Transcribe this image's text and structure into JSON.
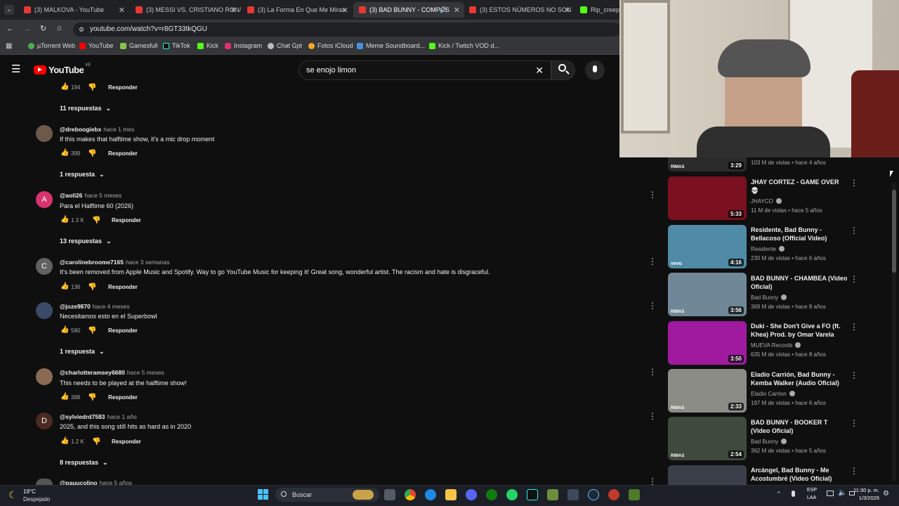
{
  "browser": {
    "tabs": [
      {
        "label": "(3) MALKOVA - YouTube",
        "active": false
      },
      {
        "label": "(3) MESSI VS. CRISTIANO RON/",
        "active": false
      },
      {
        "label": "(3) La Forma En Que Me Miras",
        "active": false
      },
      {
        "label": "(3) BAD BUNNY - COMPOS",
        "active": true
      },
      {
        "label": "(3) ESTOS NÚMEROS NO SON",
        "active": false
      },
      {
        "label": "Rip_creepy S",
        "active": false
      }
    ],
    "url": "youtube.com/watch?v=r8GT33tkQGU",
    "bookmarks": [
      "µTorrent Web",
      "YouTube",
      "Gamesfull",
      "TikTok",
      "Kick",
      "Instagram",
      "Chat Gpt",
      "Fotos iCloud",
      "Meme Soundboard...",
      "Kick / Twitch VOD d..."
    ]
  },
  "youtube": {
    "logo_text": "YouTube",
    "region": "VE",
    "search_value": "se enojo limon"
  },
  "comments": {
    "top_item": {
      "likes": "194",
      "reply_label": "Responder",
      "replies": "11 respuestas"
    },
    "items": [
      {
        "handle": "@dreboogiebx",
        "time": "hace 1 mes",
        "text": "If this makes that halftime show, it's a mic drop moment",
        "likes": "399",
        "reply_label": "Responder",
        "replies": "1 respuesta",
        "avatar_letter": "",
        "avatar_color": "#6b5a4a"
      },
      {
        "handle": "@aoli26",
        "time": "hace 5 meses",
        "text": "Para el Halftime 60 (2026)",
        "likes": "1.3 K",
        "reply_label": "Responder",
        "replies": "13 respuestas",
        "avatar_letter": "A",
        "avatar_color": "#d6336c"
      },
      {
        "handle": "@carolinebroome7165",
        "time": "hace 3 semanas",
        "text": "It's been removed from Apple Music and Spotify. Way to go YouTube Music for keeping it! Great song, wonderful artist. The racism and hate is disgraceful.",
        "likes": "136",
        "reply_label": "Responder",
        "replies": "",
        "avatar_letter": "C",
        "avatar_color": "#616161"
      },
      {
        "handle": "@joze9870",
        "time": "hace 4 meses",
        "text": "Necesitamos esto en el Superbowl",
        "likes": "580",
        "reply_label": "Responder",
        "replies": "1 respuesta",
        "avatar_letter": "",
        "avatar_color": "#3b4a66"
      },
      {
        "handle": "@charlotteramsey6680",
        "time": "hace 5 meses",
        "text": "This needs to be played at the halftime show!",
        "likes": "388",
        "reply_label": "Responder",
        "replies": "",
        "avatar_letter": "",
        "avatar_color": "#8a6a52"
      },
      {
        "handle": "@sylviedrd7583",
        "time": "hace 1 año",
        "text": "2025, and this song still hits as hard as in 2020",
        "likes": "1.2 K",
        "reply_label": "Responder",
        "replies": "8 respuestas",
        "avatar_letter": "D",
        "avatar_color": "#4a2b22"
      },
      {
        "handle": "@pauucolino",
        "time": "hace 5 años",
        "text": "",
        "likes": "",
        "reply_label": "",
        "replies": "",
        "avatar_letter": "",
        "avatar_color": "#555555"
      }
    ]
  },
  "sidebar_videos": [
    {
      "title": "",
      "channel": "",
      "meta": "103 M de vistas • hace 4 años",
      "duration": "3:29",
      "verified": false,
      "thumb_color": "#2b2b2b",
      "brand": "RIMAS"
    },
    {
      "title": "JHAY CORTEZ - GAME OVER 💀",
      "channel": "JHAYCO",
      "meta": "11 M de vistas • hace 5 años",
      "duration": "5:33",
      "verified": true,
      "thumb_color": "#7a1020",
      "brand": ""
    },
    {
      "title": "Residente, Bad Bunny - Bellacoso (Official Video)",
      "channel": "Residente",
      "meta": "230 M de vistas • hace 6 años",
      "duration": "4:16",
      "verified": true,
      "thumb_color": "#4f8aa6",
      "brand": "vevo"
    },
    {
      "title": "BAD BUNNY - CHAMBEA (Video Oficial)",
      "channel": "Bad Bunny",
      "meta": "369 M de vistas • hace 8 años",
      "duration": "3:56",
      "verified": true,
      "thumb_color": "#6f8797",
      "brand": "RIMAS"
    },
    {
      "title": "Duki - She Don't Give a FO (ft. Khea) Prod. by Omar Varela",
      "channel": "MUEVA Records",
      "meta": "635 M de vistas • hace 8 años",
      "duration": "3:50",
      "verified": true,
      "thumb_color": "#a01aa0",
      "brand": ""
    },
    {
      "title": "Eladio Carrión, Bad Bunny - Kemba Walker (Audio Oficial)",
      "channel": "Eladio Carrion",
      "meta": "197 M de vistas • hace 6 años",
      "duration": "2:33",
      "verified": true,
      "thumb_color": "#8c8c86",
      "brand": "RIMAS"
    },
    {
      "title": "BAD BUNNY - BOOKER T (Video Oficial)",
      "channel": "Bad Bunny",
      "meta": "362 M de vistas • hace 5 años",
      "duration": "2:54",
      "verified": true,
      "thumb_color": "#3e4a3c",
      "brand": "RIMAS"
    },
    {
      "title": "Arcángel, Bad Bunny - Me Acostumbré (Video Oficial)",
      "channel": "",
      "meta": "",
      "duration": "",
      "verified": false,
      "thumb_color": "#3b3f4a",
      "brand": ""
    }
  ],
  "taskbar": {
    "weather_temp": "19°C",
    "weather_desc": "Despejado",
    "search_placeholder": "Buscar",
    "lang_top": "ESP",
    "lang_bottom": "LAA",
    "time": "11:30 p. m.",
    "date": "1/3/2026"
  },
  "colors": {
    "bg": "#0f0f0f",
    "yt_red": "#ff0000",
    "tab_bar": "#202124",
    "taskbar": "#1c1f26"
  }
}
